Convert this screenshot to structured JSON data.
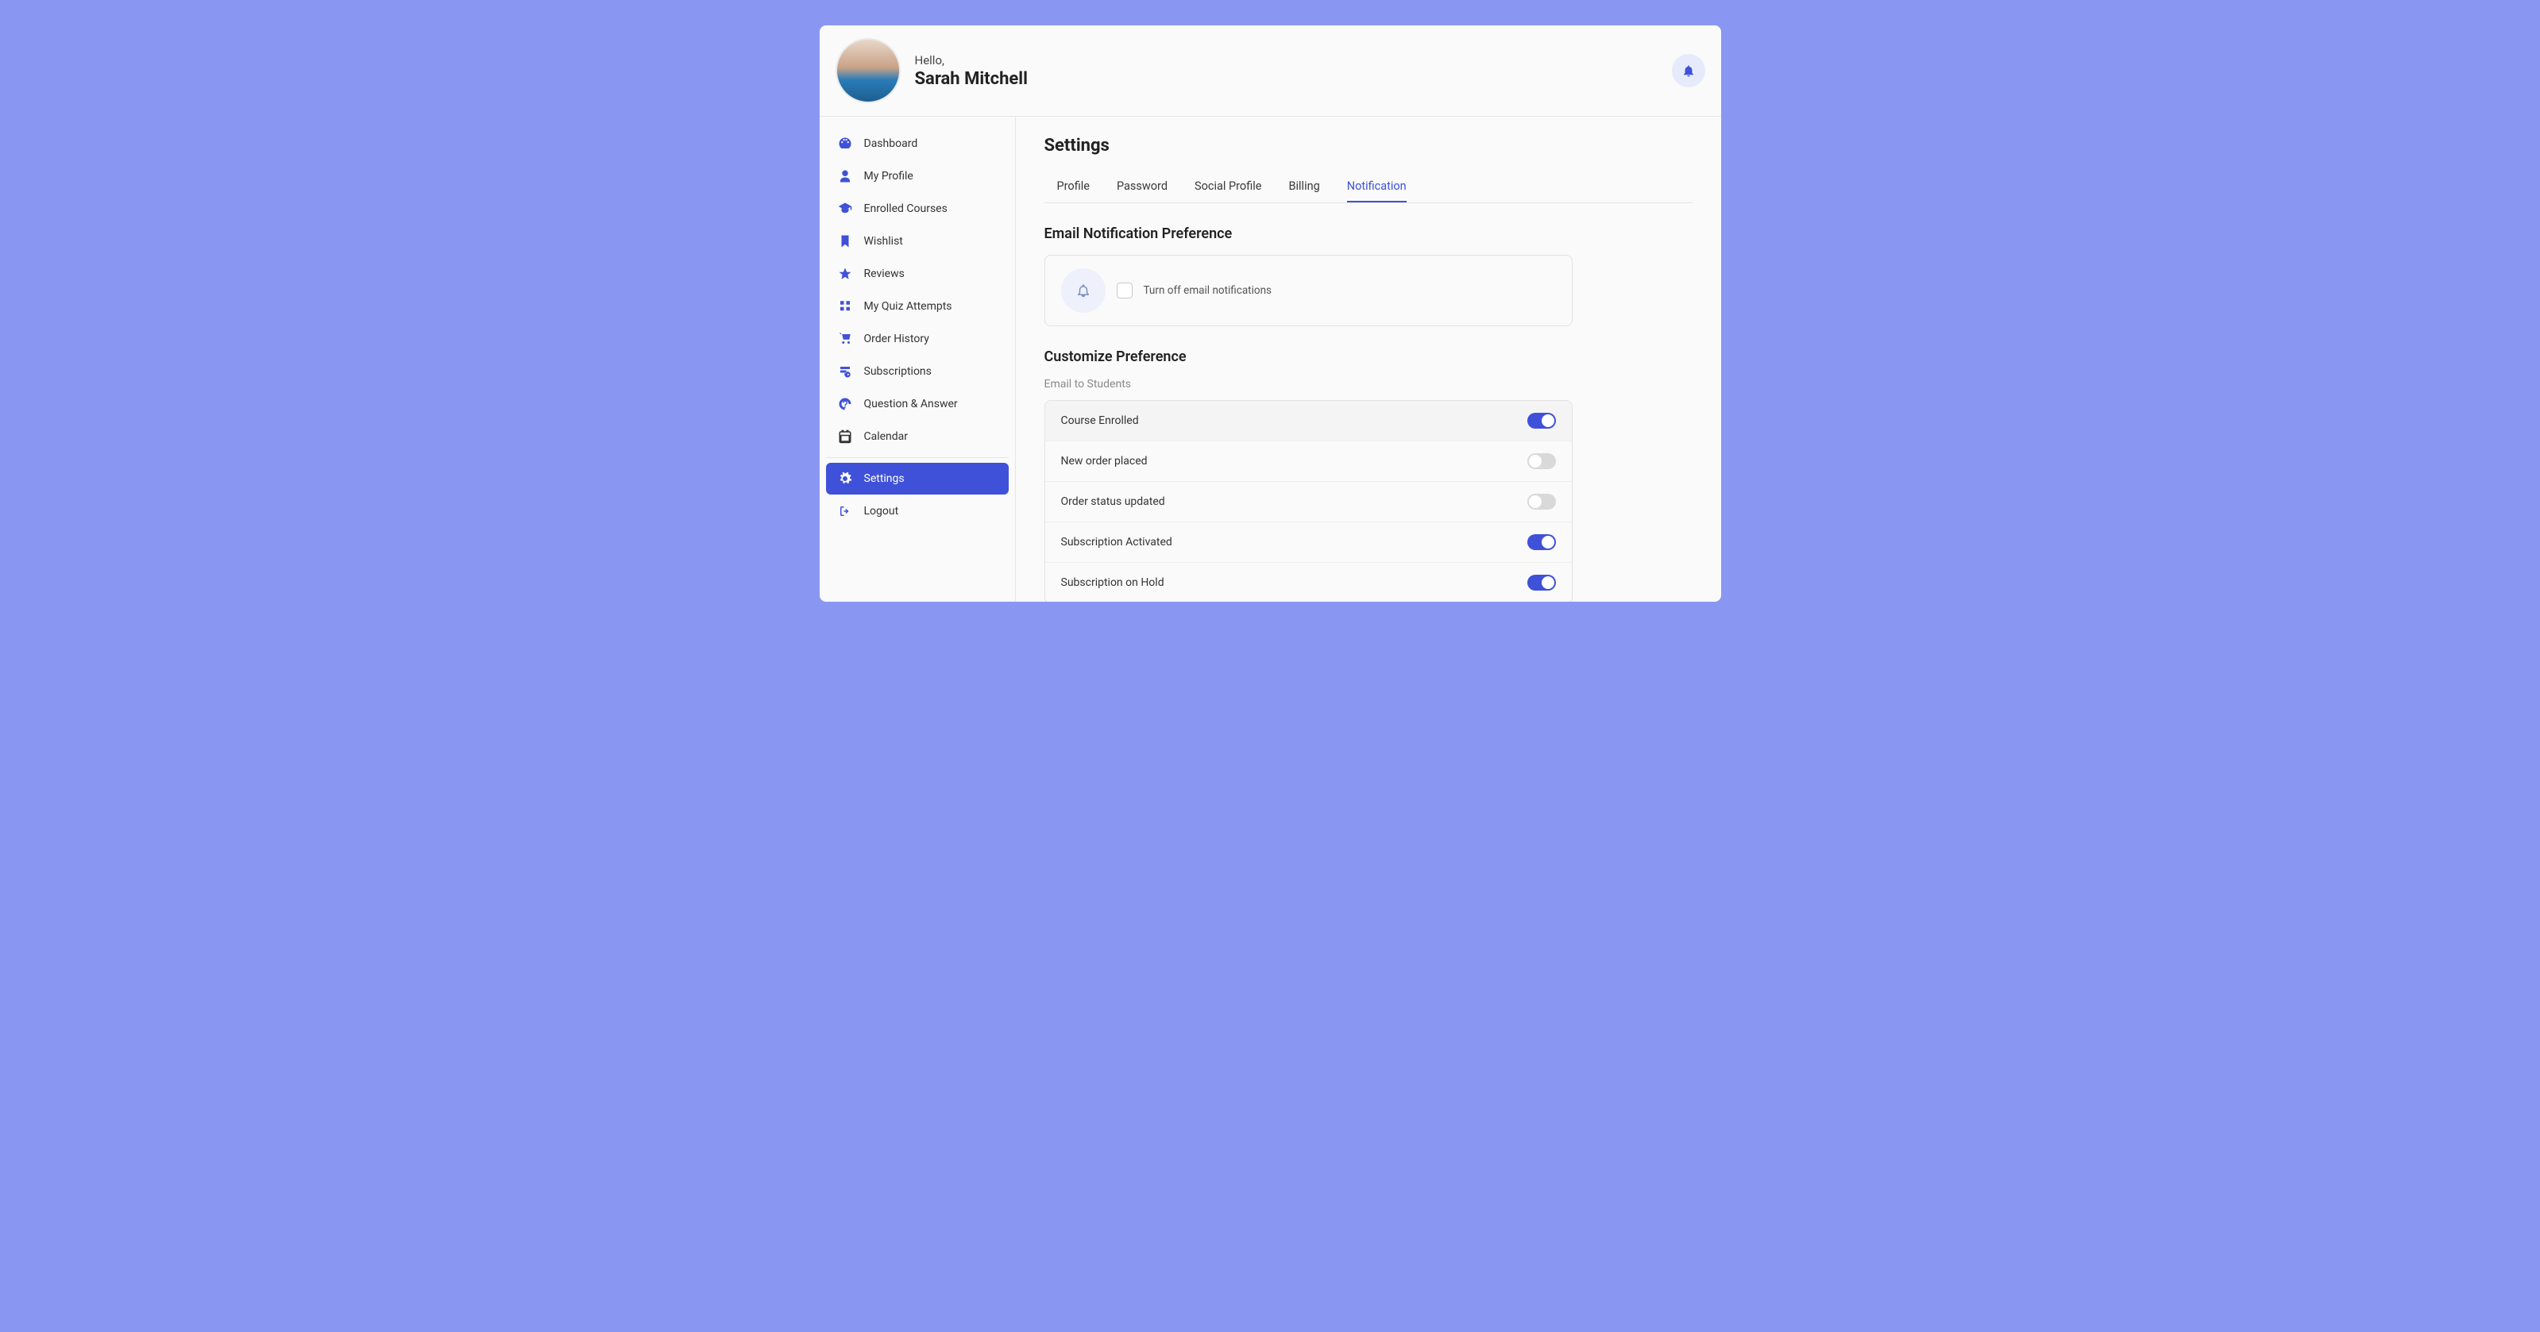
{
  "header": {
    "greeting": "Hello,",
    "username": "Sarah Mitchell"
  },
  "sidebar": {
    "items": [
      {
        "icon": "dashboard-icon",
        "label": "Dashboard"
      },
      {
        "icon": "user-icon",
        "label": "My Profile"
      },
      {
        "icon": "graduation-icon",
        "label": "Enrolled Courses"
      },
      {
        "icon": "bookmark-icon",
        "label": "Wishlist"
      },
      {
        "icon": "star-icon",
        "label": "Reviews"
      },
      {
        "icon": "quiz-icon",
        "label": "My Quiz Attempts"
      },
      {
        "icon": "cart-icon",
        "label": "Order History"
      },
      {
        "icon": "subscription-icon",
        "label": "Subscriptions"
      },
      {
        "icon": "qa-icon",
        "label": "Question & Answer"
      },
      {
        "icon": "calendar-icon",
        "label": "Calendar"
      },
      {
        "icon": "gear-icon",
        "label": "Settings"
      },
      {
        "icon": "logout-icon",
        "label": "Logout"
      }
    ]
  },
  "page_title": "Settings",
  "tabs": [
    {
      "label": "Profile"
    },
    {
      "label": "Password"
    },
    {
      "label": "Social Profile"
    },
    {
      "label": "Billing"
    },
    {
      "label": "Notification",
      "active": true
    }
  ],
  "email_pref": {
    "title": "Email Notification Preference",
    "checkbox_label": "Turn off email notifications",
    "checked": false
  },
  "customize": {
    "title": "Customize Preference",
    "sub_label": "Email to Students",
    "rows": [
      {
        "label": "Course Enrolled",
        "on": true
      },
      {
        "label": "New order placed",
        "on": false
      },
      {
        "label": "Order status updated",
        "on": false
      },
      {
        "label": "Subscription Activated",
        "on": true
      },
      {
        "label": "Subscription on Hold",
        "on": true
      }
    ]
  }
}
